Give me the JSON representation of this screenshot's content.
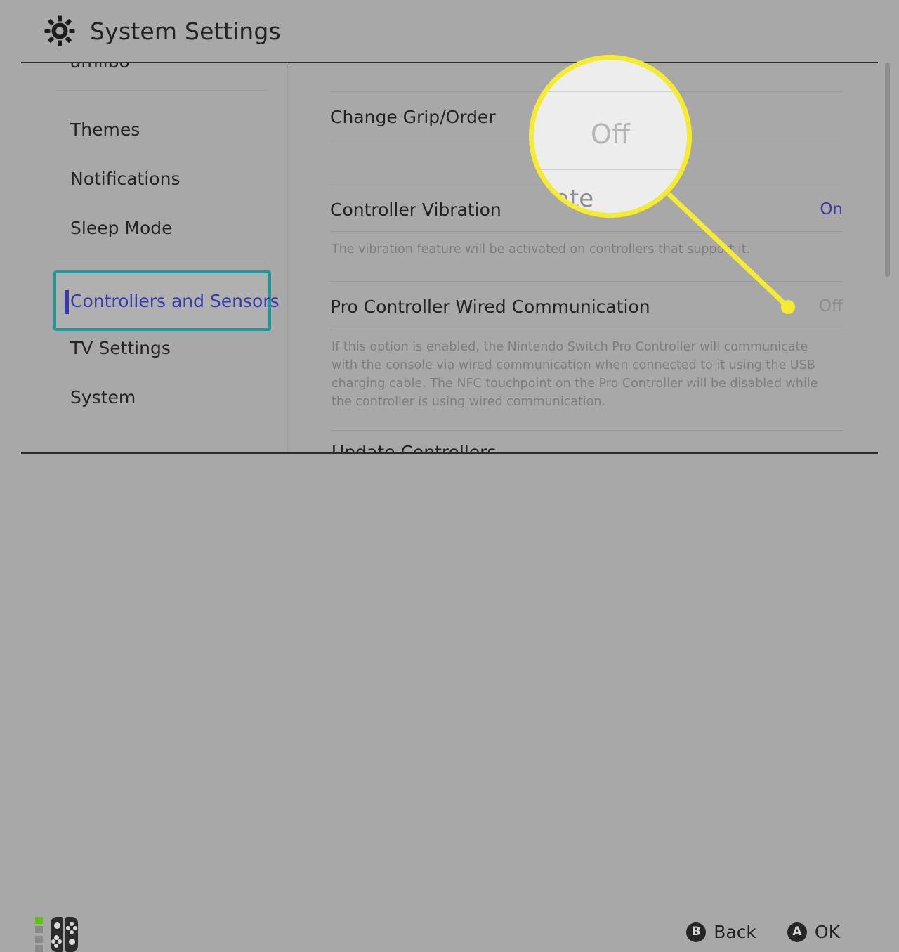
{
  "header": {
    "title": "System Settings",
    "icon": "gear-icon"
  },
  "sidebar": {
    "clipped_top_item": "amiibo",
    "items": [
      {
        "label": "Themes",
        "selected": false
      },
      {
        "label": "Notifications",
        "selected": false
      },
      {
        "label": "Sleep Mode",
        "selected": false
      },
      {
        "label": "Controllers and Sensors",
        "selected": true
      },
      {
        "label": "TV Settings",
        "selected": false
      },
      {
        "label": "System",
        "selected": false
      }
    ],
    "selected_border_color": "#1a9a9a",
    "selected_text_color": "#3a3aa8"
  },
  "content": {
    "rows": [
      {
        "label": "Change Grip/Order",
        "value": "",
        "value_state": "",
        "description": ""
      },
      {
        "label": "Controller Vibration",
        "value": "On",
        "value_state": "on",
        "description": "The vibration feature will be activated on controllers that support it."
      },
      {
        "label": "Pro Controller Wired Communication",
        "value": "Off",
        "value_state": "off",
        "description": "If this option is enabled, the Nintendo Switch Pro Controller will communicate with the console via wired communication when connected to it using the USB charging cable. The NFC touchpoint on the Pro Controller will be disabled while the controller is using wired communication."
      }
    ],
    "clipped_bottom_row": "Update Controllers",
    "value_on_color": "#3a3aa8",
    "value_off_color": "#8d8d8d"
  },
  "magnifier": {
    "magnified_value": "Off",
    "magnified_partial_text": "icate",
    "ring_color": "#f5eb32",
    "target_label": "Pro Controller Wired Communication value"
  },
  "footer": {
    "battery_icon": "joycon-battery-indicator",
    "controller_icon": "joy-con-pair-icon",
    "buttons": [
      {
        "glyph": "B",
        "label": "Back"
      },
      {
        "glyph": "A",
        "label": "OK"
      }
    ]
  },
  "scrollbar": {
    "orientation": "vertical"
  }
}
